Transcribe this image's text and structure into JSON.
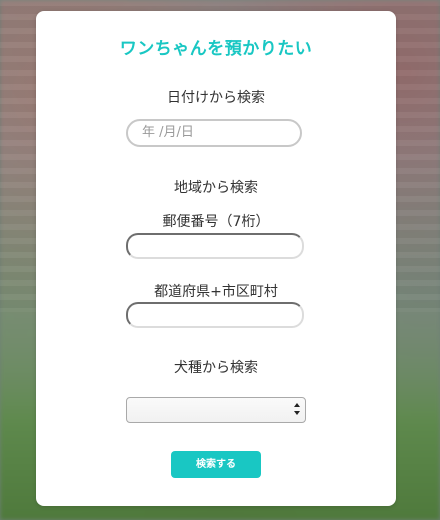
{
  "form": {
    "title": "ワンちゃんを預かりたい",
    "date_section_label": "日付けから検索",
    "date_placeholder": "年 /月/日",
    "area_section_label": "地域から検索",
    "zip_label": "郵便番号（7桁）",
    "zip_value": "",
    "address_label": "都道府県+市区町村",
    "address_value": "",
    "breed_section_label": "犬種から検索",
    "breed_selected": "",
    "submit_label": "検索する"
  },
  "colors": {
    "accent": "#19c7c3",
    "card_background": "#ffffff",
    "label_text": "#333333"
  }
}
